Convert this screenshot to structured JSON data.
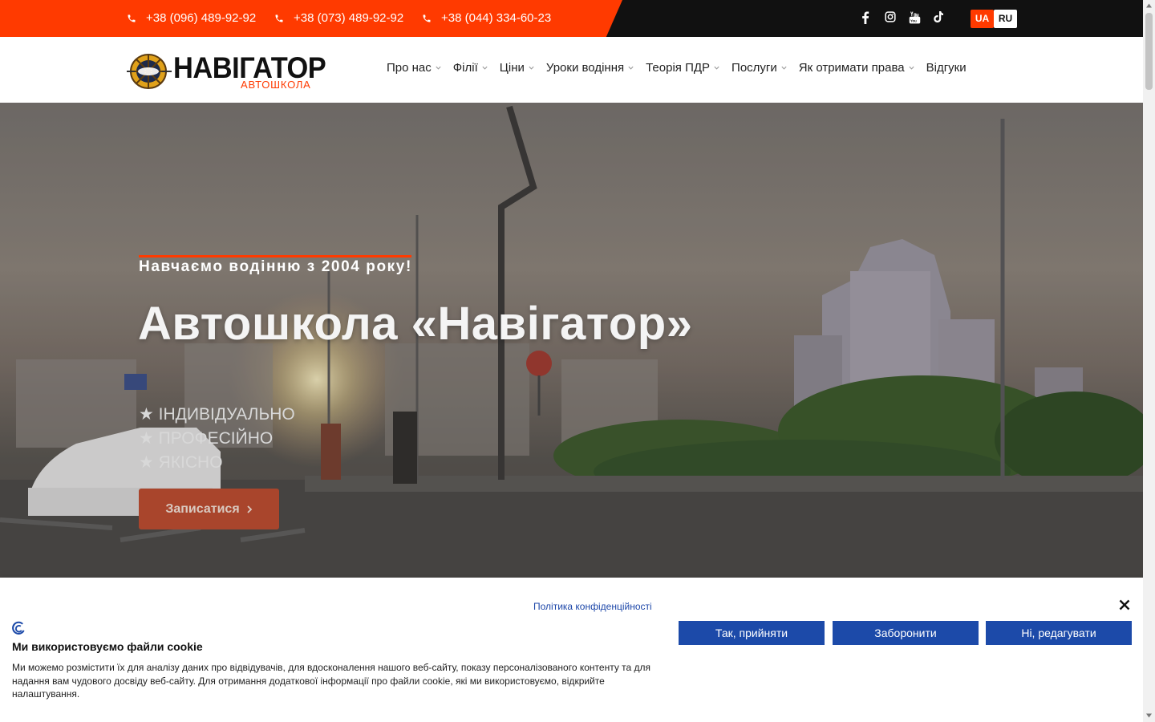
{
  "topbar": {
    "phones": [
      "+38 (096) 489-92-92",
      "+38 (073) 489-92-92",
      "+38 (044) 334-60-23"
    ],
    "socials": [
      "facebook-icon",
      "instagram-icon",
      "youtube-icon",
      "tiktok-icon"
    ],
    "languages": {
      "ua": "UA",
      "ru": "RU",
      "active": "UA"
    }
  },
  "header": {
    "logo_title": "НАВІГАТОР",
    "logo_sub": "АВТОШКОЛА",
    "nav": [
      {
        "label": "Про нас",
        "dropdown": true
      },
      {
        "label": "Філії",
        "dropdown": true
      },
      {
        "label": "Ціни",
        "dropdown": true
      },
      {
        "label": "Уроки водіння",
        "dropdown": true
      },
      {
        "label": "Теорія ПДР",
        "dropdown": true
      },
      {
        "label": "Послуги",
        "dropdown": true
      },
      {
        "label": "Як отримати права",
        "dropdown": true
      },
      {
        "label": "Відгуки",
        "dropdown": false
      }
    ]
  },
  "hero": {
    "kicker": "Навчаємо водінню з 2004 року!",
    "title": "Автошкола «Навігатор»",
    "bullets": [
      "★ ІНДИВІДУАЛЬНО",
      "★ ПРОФЕСІЙНО",
      "★ ЯКІСНО"
    ],
    "button": "Записатися"
  },
  "cookie": {
    "policy_link": "Політика конфіденційності",
    "title": "Ми використовуємо файли cookie",
    "text": "Ми можемо розмістити їх для аналізу даних про відвідувачів, для вдосконалення нашого веб-сайту, показу персоналізованого контенту та для надання вам чудового досвіду веб-сайту. Для отримання додаткової інформації про файли cookie, які ми використовуємо, відкрийте налаштування.",
    "buttons": [
      "Так, прийняти",
      "Заборонити",
      "Ні, редагувати"
    ]
  },
  "colors": {
    "accent": "#ff3a00",
    "topbar_dark": "#111111",
    "cookie_button": "#1c4aa9"
  }
}
